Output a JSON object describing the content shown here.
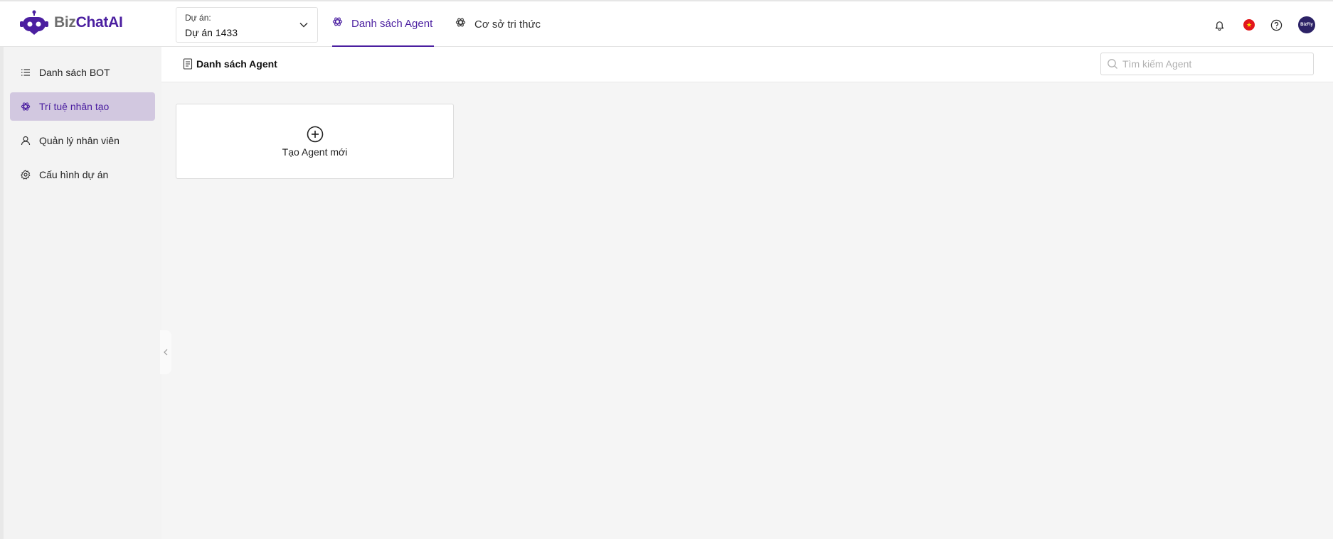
{
  "header": {
    "logo": {
      "part1": "Biz",
      "part2": "ChatAI",
      "icon": "robot-logo-icon"
    },
    "project": {
      "label": "Dự án:",
      "value": "Dự án 1433"
    },
    "tabs": [
      {
        "label": "Danh sách Agent",
        "active": true,
        "icon": "openai-icon"
      },
      {
        "label": "Cơ sở tri thức",
        "active": false,
        "icon": "openai-icon"
      }
    ],
    "icons": [
      "bell-icon",
      "vietnam-flag-icon",
      "help-icon",
      "avatar"
    ],
    "avatar_text": "BizFly"
  },
  "sidebar": {
    "items": [
      {
        "label": "Danh sách BOT",
        "icon": "list-icon",
        "active": false
      },
      {
        "label": "Trí tuệ nhân tạo",
        "icon": "openai-icon",
        "active": true
      },
      {
        "label": "Quản lý nhân viên",
        "icon": "user-icon",
        "active": false
      },
      {
        "label": "Cấu hình dự án",
        "icon": "gear-icon",
        "active": false
      }
    ]
  },
  "main": {
    "title": "Danh sách Agent",
    "search": {
      "placeholder": "Tìm kiếm Agent"
    },
    "create_card": {
      "label": "Tạo Agent mới"
    }
  },
  "colors": {
    "primary": "#4b1fa0",
    "active_bg": "#d2c8e0",
    "sidebar_bg": "#f3f3f3",
    "content_bg": "#f5f5f5"
  }
}
